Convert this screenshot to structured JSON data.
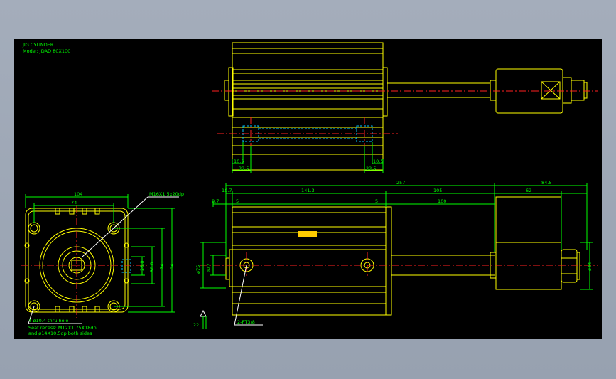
{
  "title_block": {
    "line1": "JIG CYLINDER",
    "line2": "Model: JDAD 80X100"
  },
  "front_view": {
    "dim_top_outer": "104",
    "dim_top_inner": "74",
    "dim_right_1": "38.8",
    "dim_right_2": "26.8",
    "dim_right_3": "74",
    "dim_right_4": "94",
    "leader_top": "M16X1.5x20dp",
    "note_line1": "4-ø10.4 thru hole",
    "note_line2": "Seat recess: M12X1.75X18dp",
    "note_line3": "and ø14X10.5dp both sides"
  },
  "top_view": {
    "dim_left_a": "10.5",
    "dim_left_b": "22.5",
    "dim_right_a": "22.5",
    "dim_right_b": "10.5"
  },
  "side_view": {
    "dim_overall": "257",
    "dim_end": "84.5",
    "dim_10_7": "10.7",
    "dim_141_3": "141.3",
    "dim_105": "105",
    "dim_62": "62",
    "dim_8_7": "8.7",
    "dim_5_left": "5",
    "dim_5_right": "5",
    "dim_100": "100",
    "dim_dia_a": "ø75",
    "dim_dia_b": "ø22",
    "dim_right_dia": "ø44",
    "dim_bottom_22": "22",
    "port_label": "2-PT3/8"
  }
}
